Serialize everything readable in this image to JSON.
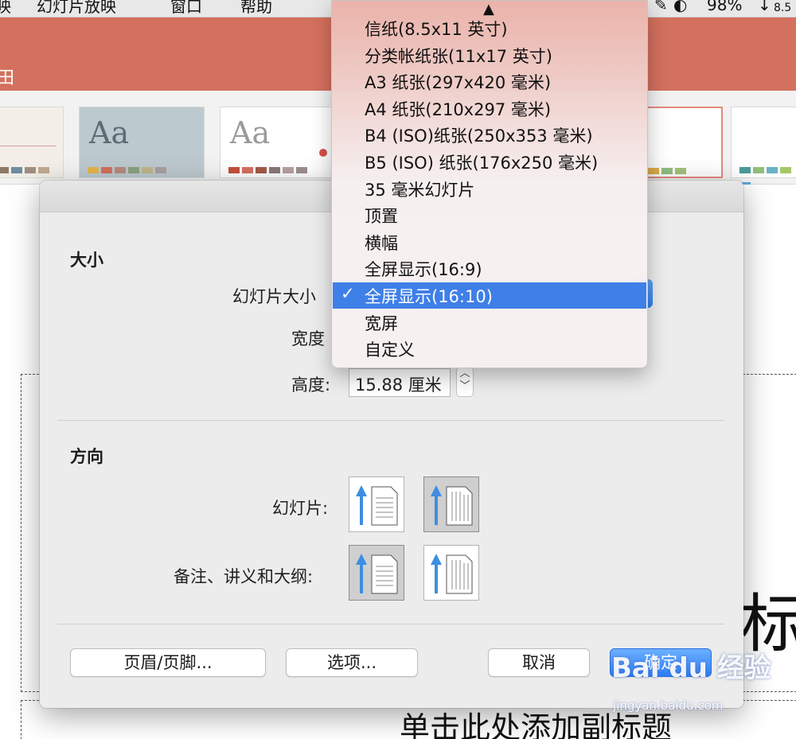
{
  "menubar": {
    "items": [
      "映",
      "幻灯片放映",
      "窗口",
      "帮助"
    ],
    "battery": "98%",
    "clock_fragment": "8.5"
  },
  "ribbon": {
    "tab_fragment": "田",
    "theme_preview_label": "Aa"
  },
  "dialog": {
    "size_section": "大小",
    "slide_size_label": "幻灯片大小",
    "width_label": "宽度",
    "height_label": "高度:",
    "height_value": "15.88 厘米",
    "orientation_section": "方向",
    "slides_label": "幻灯片:",
    "notes_label": "备注、讲义和大纲:",
    "buttons": {
      "header_footer": "页眉/页脚...",
      "options": "选项...",
      "cancel": "取消",
      "ok": "确定"
    }
  },
  "size_menu": {
    "scroll_up": "▲",
    "selected_index": 10,
    "check": "✓",
    "items": [
      "信纸(8.5x11 英寸)",
      "分类帐纸张(11x17 英寸)",
      "A3 纸张(297x420 毫米)",
      "A4 纸张(210x297 毫米)",
      "B4 (ISO)纸张(250x353 毫米)",
      "B5 (ISO) 纸张(176x250 毫米)",
      "35 毫米幻灯片",
      "顶置",
      "横幅",
      "全屏显示(16:9)",
      "全屏显示(16:10)",
      "宽屏",
      "自定义"
    ]
  },
  "slide": {
    "title_fragment": "标",
    "subtitle": "单击此处添加副标题"
  },
  "watermark": {
    "brand": "Bai du 经验",
    "url": "jingyan.baidu.com"
  },
  "colors": {
    "ribbon": "#d4705e",
    "accent_blue": "#3f7fe8",
    "arrow_blue": "#3d8ee0"
  }
}
